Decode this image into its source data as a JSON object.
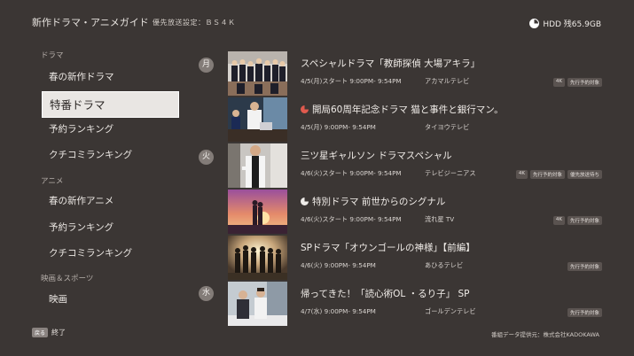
{
  "header": {
    "title": "新作ドラマ・アニメガイド",
    "priority_label": "優先放送設定：ＢＳ４Ｋ",
    "hdd": "HDD 残65.9GB",
    "hdd_icon": "pie-icon"
  },
  "sidebar": {
    "drama_heading": "ドラマ",
    "drama_items": [
      "春の新作ドラマ",
      "特番ドラマ",
      "予約ランキング",
      "クチコミランキング"
    ],
    "anime_heading": "アニメ",
    "anime_items": [
      "春の新作アニメ",
      "予約ランキング",
      "クチコミランキング"
    ],
    "movies_heading": "映画＆スポーツ",
    "movies_items": [
      "映画"
    ],
    "selected_item": "特番ドラマ"
  },
  "days": [
    "月",
    "火",
    "水"
  ],
  "programs": [
    {
      "title": "スペシャルドラマ「教師探偵 大場アキラ」",
      "time": "4/5(月)スタート 9:00PM- 9:54PM",
      "station": "アカマルテレビ",
      "badges": [
        "4K",
        "先行予約対象"
      ]
    },
    {
      "title": "開局60周年記念ドラマ 猫と事件と銀行マン。",
      "time": "4/5(月) 9:00PM- 9:54PM",
      "station": "タイヨウテレビ",
      "badges": [],
      "icon": "recording-red-icon"
    },
    {
      "title": "三ツ星ギャルソン ドラマスペシャル",
      "time": "4/6(火)スタート 9:00PM- 9:54PM",
      "station": "テレビジーニアス",
      "badges": [
        "4K",
        "先行予約対象",
        "優先放送待ち"
      ]
    },
    {
      "title": "特別ドラマ 前世からのシグナル",
      "time": "4/6(火)スタート 9:00PM- 9:54PM",
      "station": "流れ星 TV",
      "badges": [
        "4K",
        "先行予約対象"
      ],
      "icon": "recording-white-icon"
    },
    {
      "title": "SPドラマ「オウンゴールの神様」【前編】",
      "time": "4/6(火) 9:00PM- 9:54PM",
      "station": "あひるテレビ",
      "badges": [
        "先行予約対象"
      ]
    },
    {
      "title": "帰ってきた！「読心術OL ・るり子」 SP",
      "time": "4/7(水) 9:00PM- 9:54PM",
      "station": "ゴールデンテレビ",
      "badges": [
        "先行予約対象"
      ]
    }
  ],
  "footer": {
    "back_key": "戻る",
    "back_label": "終了",
    "credit": "番組データ提供元：株式会社KADOKAWA"
  },
  "colors": {
    "background": "#3b3634",
    "selected": "#e9e6e3",
    "day_circle": "#837c78",
    "rec_red": "#e05a4e",
    "badge": "#5a5350"
  }
}
